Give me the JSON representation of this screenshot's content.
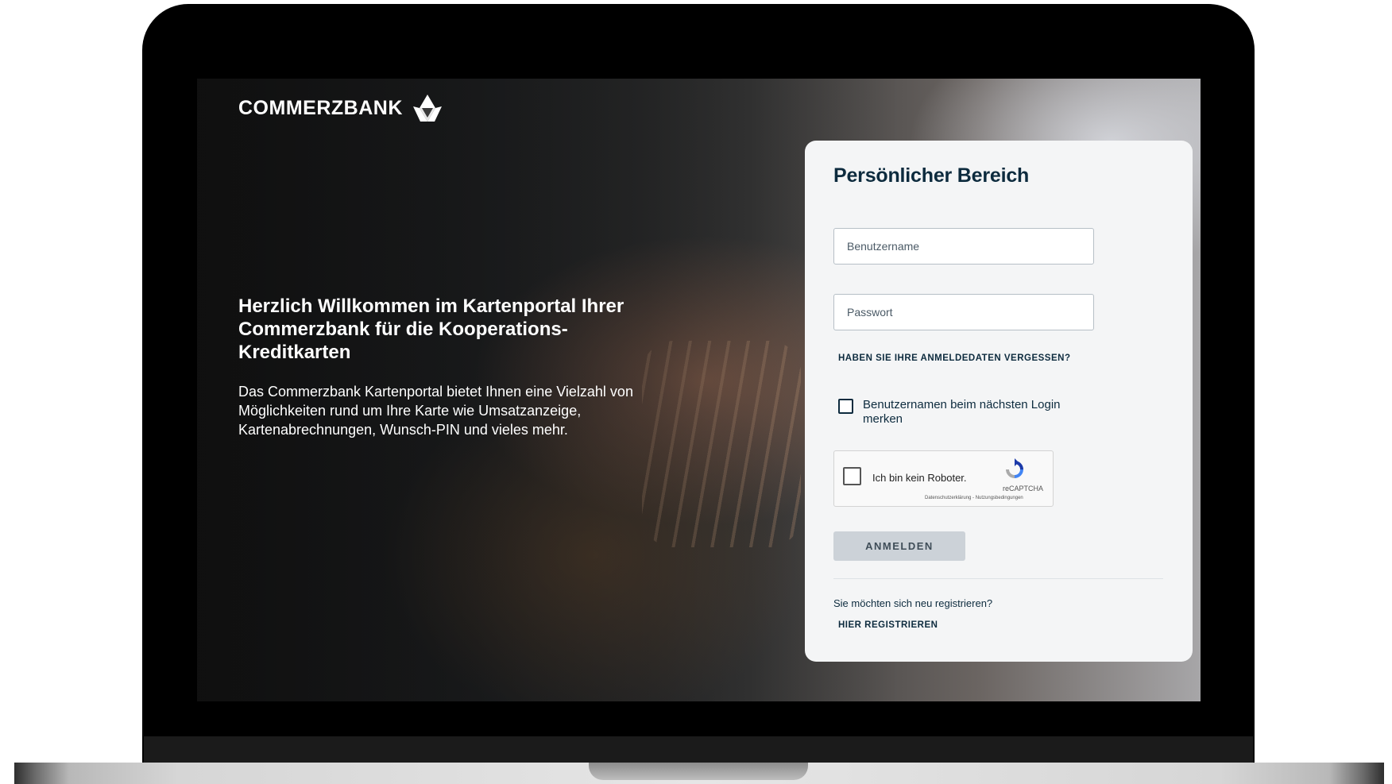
{
  "branding": {
    "logo_text": "COMMERZBANK"
  },
  "hero": {
    "title": "Herzlich Willkommen im Kartenportal Ihrer Commerzbank für die Kooperations-Kreditkarten",
    "description": "Das Commerzbank Kartenportal bietet Ihnen eine Vielzahl von Möglichkeiten rund um Ihre Karte wie Umsatzanzeige, Kartenabrechnungen, Wunsch-PIN und vieles mehr."
  },
  "login": {
    "title": "Persönlicher Bereich",
    "username_placeholder": "Benutzername",
    "password_placeholder": "Passwort",
    "forgot_link": "HABEN SIE IHRE ANMELDEDATEN VERGESSEN?",
    "remember_label": "Benutzernamen beim nächsten Login merken",
    "remember_checked": false,
    "captcha": {
      "label": "Ich bin kein Roboter.",
      "brand": "reCAPTCHA",
      "links": "Datenschutzerklärung - Nutzungsbedingungen"
    },
    "submit_label": "ANMELDEN",
    "register_question": "Sie möchten sich neu registrieren?",
    "register_link": "HIER REGISTRIEREN"
  },
  "colors": {
    "brand_dark": "#0d2b3e",
    "button_bg": "#ccd2d8",
    "card_bg": "#f4f5f6"
  }
}
